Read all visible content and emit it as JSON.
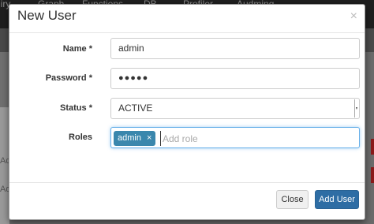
{
  "background": {
    "nav_items": [
      "uiry",
      "Graph",
      "Functions",
      "DB",
      "Profiler",
      "Audming"
    ],
    "left_fragments": [
      "Ad",
      "Add"
    ]
  },
  "modal": {
    "title": "New User",
    "close_glyph": "×",
    "fields": {
      "name": {
        "label": "Name *",
        "value": "admin"
      },
      "password": {
        "label": "Password *",
        "value": "●●●●●"
      },
      "status": {
        "label": "Status *",
        "value": "ACTIVE"
      },
      "roles": {
        "label": "Roles",
        "tags": [
          "admin"
        ],
        "tag_remove": "×",
        "placeholder": "Add role"
      }
    },
    "buttons": {
      "close": "Close",
      "add_user": "Add User"
    }
  },
  "colors": {
    "primary": "#2e6da4",
    "tag": "#3a87ad",
    "focus": "#66afe9"
  }
}
